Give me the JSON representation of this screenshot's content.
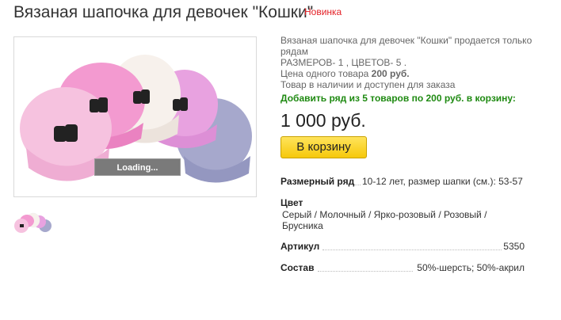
{
  "product": {
    "title": "Вязаная шапочка для девочек \"Кошки\"",
    "badge": "Новинка",
    "badge_color": "#e31e24",
    "loading_label": "Loading..."
  },
  "description": {
    "line1": "Вязаная шапочка для девочек \"Кошки\" продается только рядам",
    "line2": "РАЗМЕРОВ- 1 , ЦВЕТОВ- 5 .",
    "price_prefix": "Цена одного товара",
    "unit_price": "200 руб.",
    "line4": "Товар в наличии и доступен для заказа"
  },
  "purchase": {
    "add_row_label": "Добавить ряд из 5 товаров по 200 руб. в корзину:",
    "total_price": "1 000 руб.",
    "cart_button": "В корзину",
    "accent_color": "#1f8a12",
    "button_color": "#f6c80a"
  },
  "props": {
    "size_label": "Размерный ряд",
    "size_value": "10-12 лет, размер шапки (см.): 53-57",
    "color_label": "Цвет",
    "color_value": "Серый / Молочный / Ярко-розовый / Розовый / Брусника",
    "sku_label": "Артикул",
    "sku_value": "5350",
    "composition_label": "Состав",
    "composition_value": "50%-шерсть; 50%-акрил"
  }
}
